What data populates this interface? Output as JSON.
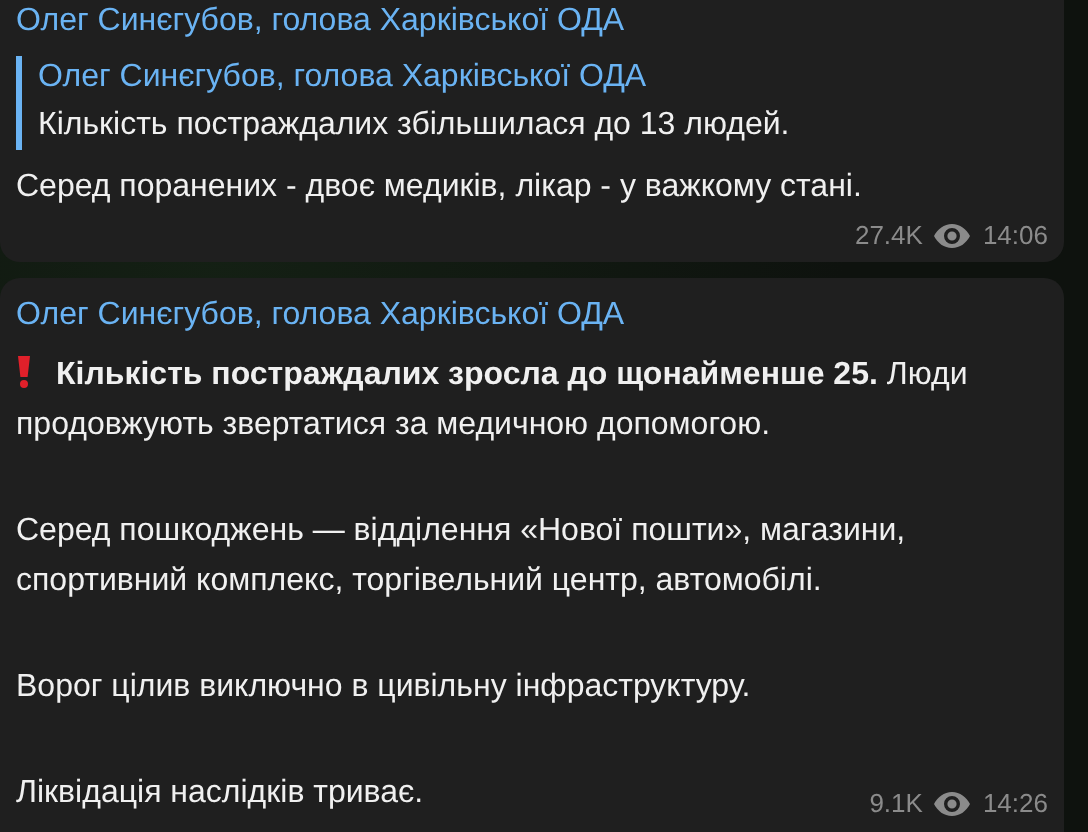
{
  "messages": [
    {
      "author": "Олег Синєгубов, голова Харківської ОДА",
      "quote": {
        "author": "Олег Синєгубов, голова Харківської ОДА",
        "text": "Кількість постраждалих збільшилася до 13 людей."
      },
      "alert": false,
      "paragraphs": [
        "Серед поранених - двоє медиків, лікар - у важкому стані."
      ],
      "views": "27.4K",
      "time": "14:06"
    },
    {
      "author": "Олег Синєгубов, голова Харківської ОДА",
      "alert": true,
      "paragraphs": [
        "**Кількість постраждалих зросла до щонайменше 25.** Люди продовжують звертатися за медичною допомогою.",
        "Серед пошкоджень — відділення «Нової пошти», магазини, спортивний комплекс, торгівельний центр, автомобілі.",
        "Ворог цілив виключно в цивільну інфраструктуру.",
        "Ліквідація наслідків триває."
      ],
      "views": "9.1K",
      "time": "14:26"
    }
  ]
}
